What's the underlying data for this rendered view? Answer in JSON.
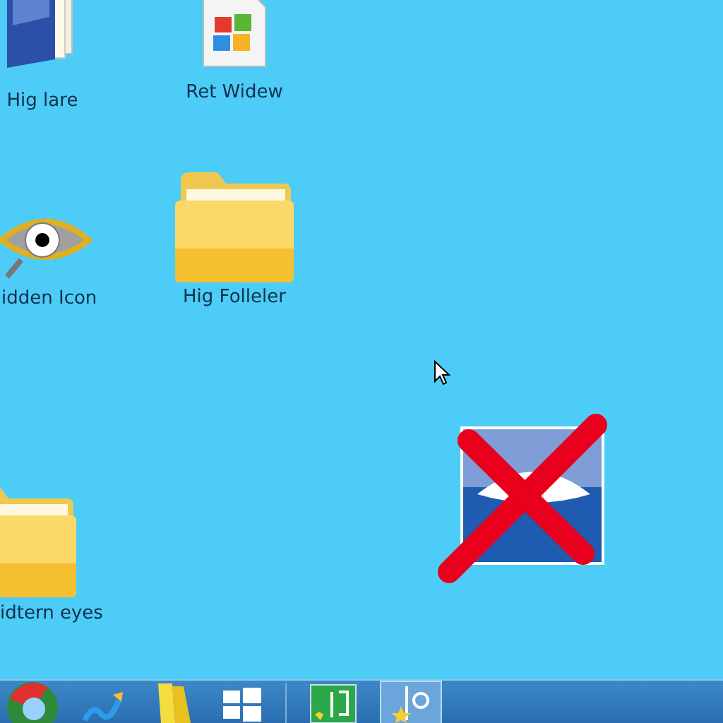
{
  "desktop": {
    "icons": [
      {
        "kind": "books",
        "label": "Hig lare"
      },
      {
        "kind": "document",
        "label": "Ret Widew"
      },
      {
        "kind": "eye",
        "label": "idden Icon"
      },
      {
        "kind": "folder",
        "label": "Hig Folleler"
      },
      {
        "kind": "folder",
        "label": "idtern eyes"
      },
      {
        "kind": "crossed-picture"
      }
    ]
  },
  "taskbar": {
    "items": [
      {
        "kind": "start",
        "selected": false
      },
      {
        "kind": "chart",
        "selected": false
      },
      {
        "kind": "note",
        "selected": false
      },
      {
        "kind": "windows",
        "selected": false
      },
      {
        "kind": "green-app",
        "selected": false
      },
      {
        "kind": "pin-app",
        "selected": true
      }
    ]
  }
}
